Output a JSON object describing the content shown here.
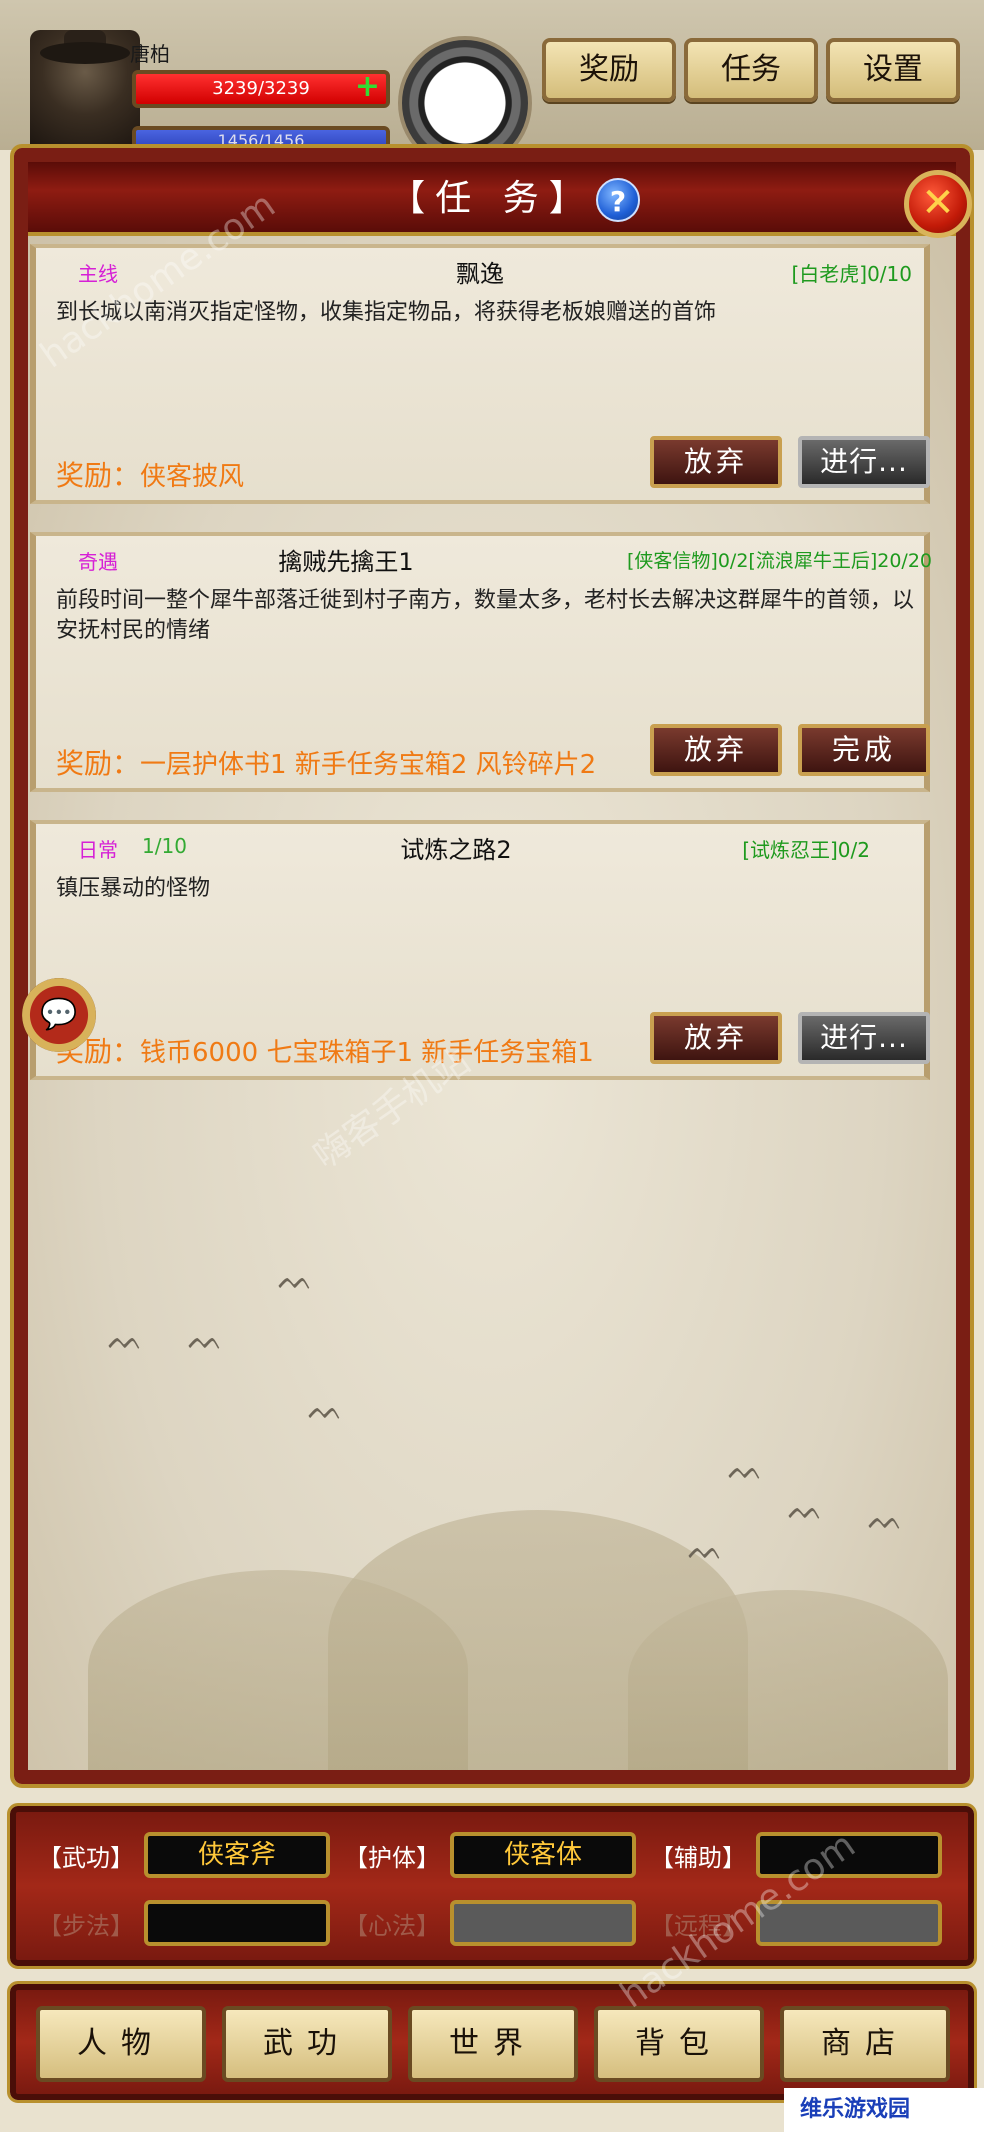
{
  "player": {
    "name": "唐柏",
    "hp_text": "3239/3239",
    "hp_plus": "+",
    "mp_text": "1456/1456"
  },
  "top_menu": {
    "reward": "奖励",
    "tasks": "任务",
    "settings": "设置"
  },
  "panel": {
    "title": "【任 务】",
    "help": "?",
    "close": "✕"
  },
  "quests": [
    {
      "type": "主线",
      "progress": "",
      "name": "飘逸",
      "goal": "[白老虎]0/10",
      "desc": "到长城以南消灭指定怪物，收集指定物品，将获得老板娘赠送的首饰",
      "reward_label": "奖励：",
      "reward_items": "侠客披风",
      "btn_left": "放弃",
      "btn_right": "进行...",
      "btn_right_style": "grey"
    },
    {
      "type": "奇遇",
      "progress": "",
      "name": "擒贼先擒王1",
      "goal": "[侠客信物]0/2[流浪犀牛王后]20/20",
      "desc": "前段时间一整个犀牛部落迁徙到村子南方，数量太多，老村长去解决这群犀牛的首领，以安抚村民的情绪",
      "reward_label": "奖励：",
      "reward_items": "一层护体书1 新手任务宝箱2 风铃碎片2",
      "btn_left": "放弃",
      "btn_right": "完成",
      "btn_right_style": "dark"
    },
    {
      "type": "日常",
      "progress": "1/10",
      "name": "试炼之路2",
      "goal": "[试炼忍王]0/2",
      "desc": "镇压暴动的怪物",
      "reward_label": "奖励：",
      "reward_items": "钱币6000 七宝珠箱子1 新手任务宝箱1",
      "btn_left": "放弃",
      "btn_right": "进行...",
      "btn_right_style": "grey"
    }
  ],
  "chat_icon": "💬",
  "equipment": {
    "row1": [
      {
        "label": "【武功】",
        "value": "侠客斧"
      },
      {
        "label": "【护体】",
        "value": "侠客体"
      },
      {
        "label": "【辅助】",
        "value": ""
      }
    ],
    "row2": [
      {
        "label": "【步法】",
        "value": ""
      },
      {
        "label": "【心法】",
        "value": ""
      },
      {
        "label": "【远程】",
        "value": ""
      }
    ]
  },
  "nav": [
    "人物",
    "武功",
    "世界",
    "背包",
    "商店"
  ],
  "watermark": "hackhome.com",
  "watermark_cn": "嗨客手机站",
  "site_badge": "维乐游戏园",
  "colors": {
    "frame_red": "#7a1e14",
    "gold": "#b8902e",
    "quest_type": "#d620d6",
    "reward": "#f07a14",
    "goal": "#1e9a1e"
  }
}
